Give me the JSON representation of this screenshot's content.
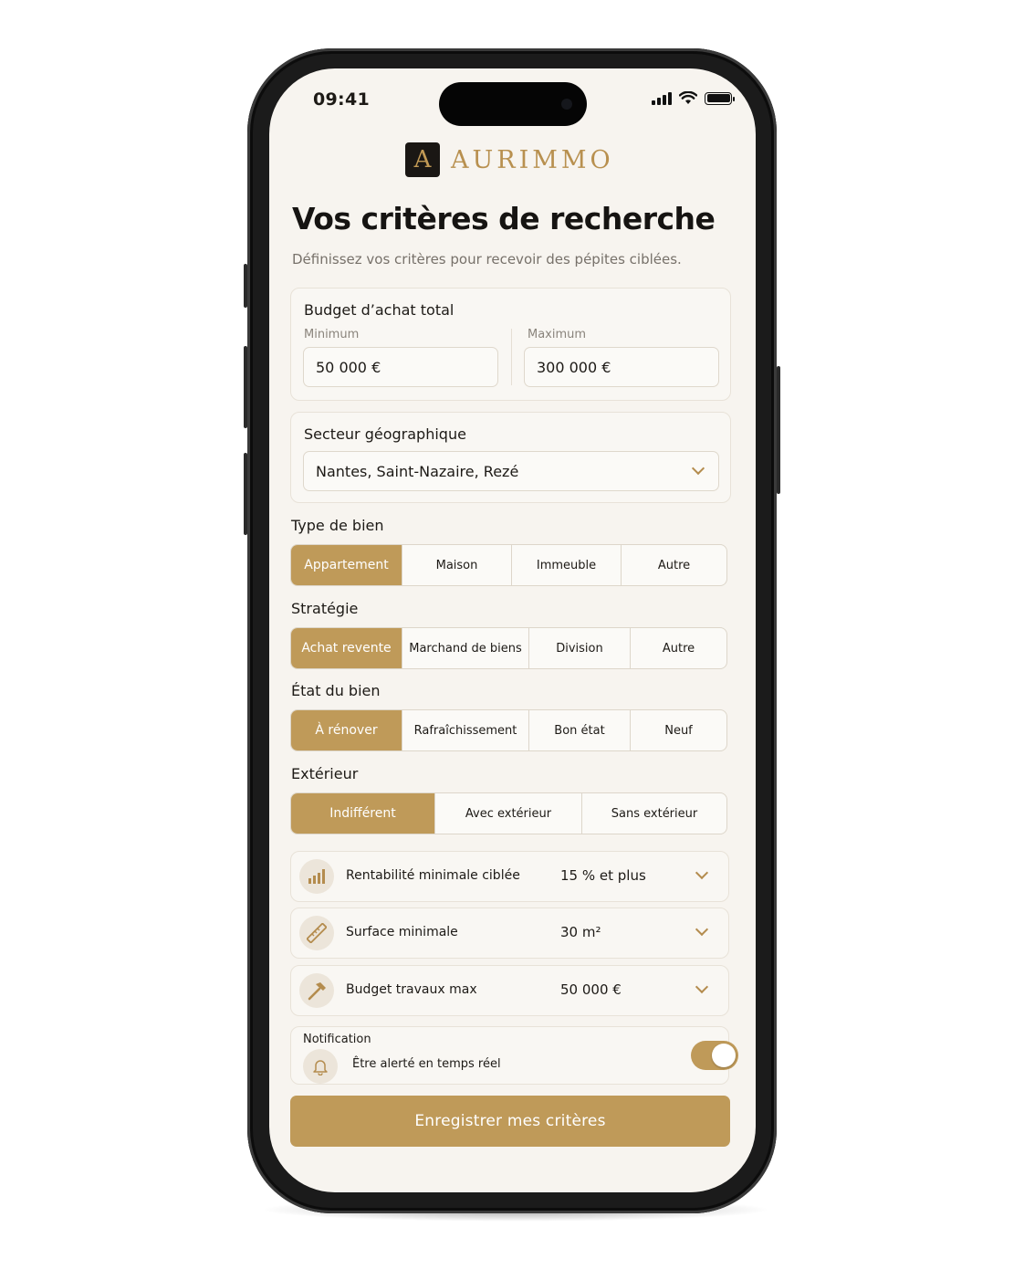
{
  "status_bar": {
    "time": "09:41"
  },
  "brand": {
    "mark": "A",
    "name": "AURIMMO",
    "color": "#b8904f"
  },
  "header": {
    "title": "Vos critères de recherche",
    "subtitle": "Définissez vos critères pour recevoir des pépites ciblées."
  },
  "budget": {
    "title": "Budget d’achat total",
    "min_label": "Minimum",
    "min_value": "50 000 €",
    "max_label": "Maximum",
    "max_value": "300 000 €"
  },
  "sector": {
    "title": "Secteur géographique",
    "value": "Nantes, Saint-Nazaire, Rezé"
  },
  "property_type": {
    "label": "Type de bien",
    "options": [
      "Appartement",
      "Maison",
      "Immeuble",
      "Autre"
    ],
    "selected": "Appartement"
  },
  "strategy": {
    "label": "Stratégie",
    "options": [
      "Achat revente",
      "Marchand de biens",
      "Division",
      "Autre"
    ],
    "selected": "Achat revente"
  },
  "condition": {
    "label": "État du bien",
    "options": [
      "À rénover",
      "Rafraîchissement",
      "Bon état",
      "Neuf"
    ],
    "selected": "À rénover"
  },
  "exterior": {
    "label": "Extérieur",
    "options": [
      "Indifférent",
      "Avec extérieur",
      "Sans extérieur"
    ],
    "selected": "Indifférent"
  },
  "criteria_rows": [
    {
      "icon": "bar-chart-icon",
      "label": "Rentabilité minimale ciblée",
      "value": "15 % et plus"
    },
    {
      "icon": "ruler-icon",
      "label": "Surface minimale",
      "value": "30 m²"
    },
    {
      "icon": "hammer-icon",
      "label": "Budget travaux max",
      "value": "50 000 €"
    }
  ],
  "notification": {
    "title": "Notification",
    "label": "Être alerté en temps réel",
    "enabled": true
  },
  "save_button": {
    "label": "Enregistrer mes critères"
  },
  "colors": {
    "accent": "#bf9a59",
    "background": "#f7f4ef",
    "text": "#1d1a16"
  }
}
